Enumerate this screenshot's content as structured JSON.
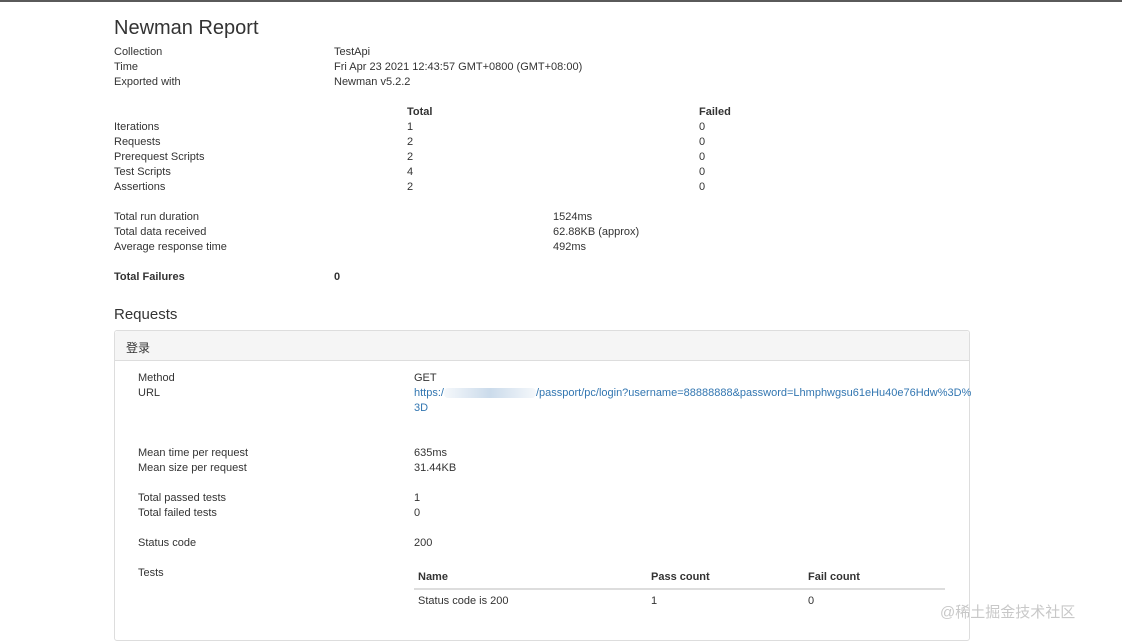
{
  "report": {
    "title": "Newman Report",
    "collection_label": "Collection",
    "collection_value": "TestApi",
    "time_label": "Time",
    "time_value": "Fri Apr 23 2021 12:43:57 GMT+0800 (GMT+08:00)",
    "exported_label": "Exported with",
    "exported_value": "Newman v5.2.2"
  },
  "summary": {
    "total_header": "Total",
    "failed_header": "Failed",
    "rows": [
      {
        "label": "Iterations",
        "total": "1",
        "failed": "0"
      },
      {
        "label": "Requests",
        "total": "2",
        "failed": "0"
      },
      {
        "label": "Prerequest Scripts",
        "total": "2",
        "failed": "0"
      },
      {
        "label": "Test Scripts",
        "total": "4",
        "failed": "0"
      },
      {
        "label": "Assertions",
        "total": "2",
        "failed": "0"
      }
    ]
  },
  "timing": {
    "rows": [
      {
        "label": "Total run duration",
        "value": "1524ms"
      },
      {
        "label": "Total data received",
        "value": "62.88KB (approx)"
      },
      {
        "label": "Average response time",
        "value": "492ms"
      }
    ]
  },
  "failures": {
    "label": "Total Failures",
    "value": "0"
  },
  "requests": {
    "heading": "Requests",
    "panel": {
      "title": "登录",
      "method_label": "Method",
      "method_value": "GET",
      "url_label": "URL",
      "url_prefix": "https:/",
      "url_suffix_line1": "/passport/pc/login?username=88888888&password=Lhmphwgsu61eHu40e76Hdw%3D%",
      "url_line2": "3D",
      "mean_time_label": "Mean time per request",
      "mean_time_value": "635ms",
      "mean_size_label": "Mean size per request",
      "mean_size_value": "31.44KB",
      "passed_label": "Total passed tests",
      "passed_value": "1",
      "failed_label": "Total failed tests",
      "failed_value": "0",
      "status_label": "Status code",
      "status_value": "200",
      "tests_label": "Tests",
      "tests_table": {
        "headers": [
          "Name",
          "Pass count",
          "Fail count"
        ],
        "rows": [
          {
            "name": "Status code is 200",
            "pass": "1",
            "fail": "0"
          }
        ]
      }
    }
  },
  "watermark": "@稀土掘金技术社区"
}
